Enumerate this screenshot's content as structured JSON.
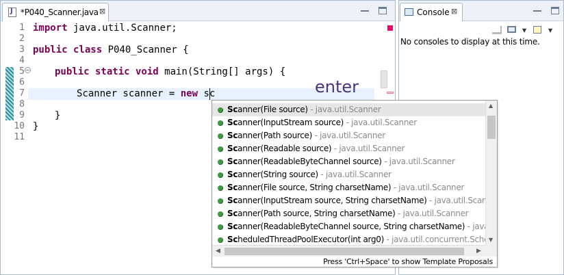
{
  "editor": {
    "tab_title": "*P040_Scanner.java",
    "tab_close": "⊠",
    "line_numbers": [
      "1",
      "2",
      "3",
      "4",
      "5",
      "6",
      "7",
      "8",
      "9",
      "10",
      "11"
    ],
    "code": {
      "l1_kw": "import",
      "l1_rest": " java.util.Scanner;",
      "l3_kw": "public class",
      "l3_rest": " P040_Scanner {",
      "l5_kw": "public static void",
      "l5_rest": " main(String[] args) {",
      "l7_text": "Scanner scanner = ",
      "l7_kw": "new",
      "l7_rest": " sc",
      "l9_text": "}",
      "l10_text": "}"
    },
    "fold_symbol": "−"
  },
  "annotation": {
    "label": "enter"
  },
  "console": {
    "tab_title": "Console",
    "tab_close": "⊠",
    "message": "No consoles to display at this time."
  },
  "content_assist": {
    "proposals": [
      {
        "bold": "Sc",
        "sig": "anner(File source)",
        "pkg": " - java.util.Scanner"
      },
      {
        "bold": "Sc",
        "sig": "anner(InputStream source)",
        "pkg": " - java.util.Scanner"
      },
      {
        "bold": "Sc",
        "sig": "anner(Path source)",
        "pkg": " - java.util.Scanner"
      },
      {
        "bold": "Sc",
        "sig": "anner(Readable source)",
        "pkg": " - java.util.Scanner"
      },
      {
        "bold": "Sc",
        "sig": "anner(ReadableByteChannel source)",
        "pkg": " - java.util.Scanner"
      },
      {
        "bold": "Sc",
        "sig": "anner(String source)",
        "pkg": " - java.util.Scanner"
      },
      {
        "bold": "Sc",
        "sig": "anner(File source, String charsetName)",
        "pkg": " - java.util.Scanner"
      },
      {
        "bold": "Sc",
        "sig": "anner(InputStream source, String charsetName)",
        "pkg": " - java.util.Scanner"
      },
      {
        "bold": "Sc",
        "sig": "anner(Path source, String charsetName)",
        "pkg": " - java.util.Scanner"
      },
      {
        "bold": "Sc",
        "sig": "anner(ReadableByteChannel source, String charsetName)",
        "pkg": " - java.util.Scanner"
      },
      {
        "bold": "Sc",
        "sig": "heduledThreadPoolExecutor(int arg0)",
        "pkg": " - java.util.concurrent.ScheduledThreadPoolExecutor"
      }
    ],
    "selected_index": 0,
    "status": "Press 'Ctrl+Space' to show Template Proposals",
    "scroll_up": "▲",
    "scroll_down": "▼",
    "scroll_left": "◀",
    "scroll_right": "▶"
  },
  "colors": {
    "keyword": "#7f0055",
    "current_line": "#e8f2fe",
    "annotation": "#48357a",
    "method_dot": "#3e9a43"
  },
  "icons": [
    "java-file-icon",
    "close-icon",
    "minimize-icon",
    "maximize-icon",
    "console-icon",
    "fold-icon",
    "method-icon",
    "pin-icon",
    "display-console-icon",
    "new-console-icon"
  ]
}
